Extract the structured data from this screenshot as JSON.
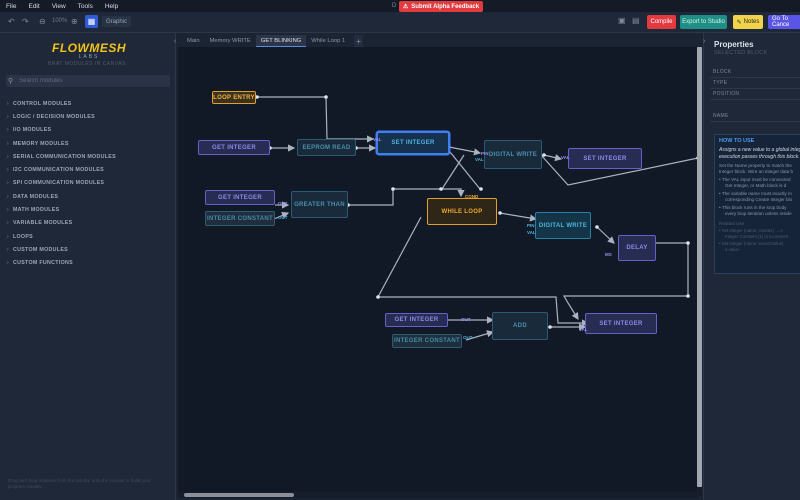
{
  "menu": {
    "items": [
      "File",
      "Edit",
      "View",
      "Tools",
      "Help"
    ],
    "window_title": "D",
    "feedback_label": "Submit Alpha Feedback"
  },
  "toolbar": {
    "zoom_label": "100%",
    "graphic_label": "Graphic",
    "compile_label": "Compile",
    "export_label": "Export to Studio",
    "notes_label": "Notes",
    "goto_label": "Go To Cance"
  },
  "sidebar": {
    "logo_text": "FLOWMESH",
    "logo_sub": "LABS",
    "tagline": "BRAT MODULES IN CANVAS",
    "search_placeholder": "Search modules",
    "modules": [
      "CONTROL MODULES",
      "LOGIC / DECISION MODULES",
      "I/O MODULES",
      "MEMORY MODULES",
      "SERIAL COMMUNICATION MODULES",
      "I2C COMMUNICATION MODULES",
      "SPI COMMUNICATION MODULES",
      "DATA MODULES",
      "MATH MODULES",
      "VARIABLE MODULES",
      "LOOPS",
      "CUSTOM MODULES",
      "CUSTOM FUNCTIONS"
    ],
    "footer": "Drag and drop modules from the sidebar onto the canvas to build your program visually."
  },
  "tabs": [
    "Main",
    "Memory WRITE",
    "GET BLINKING",
    "While Loop 1"
  ],
  "active_tab": "GET BLINKING",
  "canvas": {
    "nodes": {
      "loop_entry": "LOOP ENTRY",
      "get_integer_1": "GET INTEGER",
      "eeprom_read": "EEPROM READ",
      "set_integer_1": "SET INTEGER",
      "digital_write_1": "DIGITAL WRITE",
      "set_integer_2": "SET INTEGER",
      "get_integer_2": "GET INTEGER",
      "integer_constant_1": "INTEGER CONSTANT",
      "greater_than": "GREATER THAN",
      "while_loop": "WHILE LOOP",
      "digital_write_2": "DIGITAL WRITE",
      "delay": "DELAY",
      "get_integer_3": "GET INTEGER",
      "integer_constant_2": "INTEGER CONSTANT",
      "add": "ADD",
      "set_integer_3": "SET INTEGER"
    },
    "ports": {
      "pin": "PIN",
      "val": "VAL",
      "ms": "MS",
      "cond": "COND",
      "out": "OUT",
      "a": "A",
      "b": "B"
    }
  },
  "properties": {
    "title": "Properties",
    "subtitle": "SELECTED BLOCK",
    "fields": [
      "BLOCK",
      "TYPE",
      "POSITION",
      "NAME"
    ],
    "howto_title": "HOW TO USE",
    "howto_lead": [
      "Assigns a new value to a global integ",
      "execution passes through this block."
    ],
    "howto_text": [
      "Set the Name property to match the",
      "Integer block. Wire an integer data b"
    ],
    "howto_bullets": [
      "The VAL input must be connected",
      "Get Integer, or Math block is d",
      "The variable name must exactly m",
      "corresponding Create Integer blo",
      "This block runs in the loop body",
      "every loop iteration unless inside"
    ],
    "howto_related_title": "Related Use",
    "howto_related": [
      "Set Integer (name: counter) ... A",
      "Integer Constant (1) to increment",
      "Set Integer (name: sensorValue)",
      "a value."
    ]
  },
  "colors": {
    "accent": "#3f7ff0",
    "purple_node": "#6660c8",
    "teal_node": "#2c7fa4",
    "orange_node": "#e39f2a",
    "compile": "#e23a3f",
    "export": "#1f8f86",
    "notes": "#f1d34b",
    "goto": "#5a55e6"
  },
  "icons": [
    "undo-icon",
    "redo-icon",
    "zoom-out-icon",
    "zoom-in-icon",
    "graph-icon",
    "monitor-icon",
    "document-icon",
    "search-icon",
    "chevron-right-icon",
    "chevron-left-icon",
    "plus-icon",
    "alert-icon"
  ]
}
